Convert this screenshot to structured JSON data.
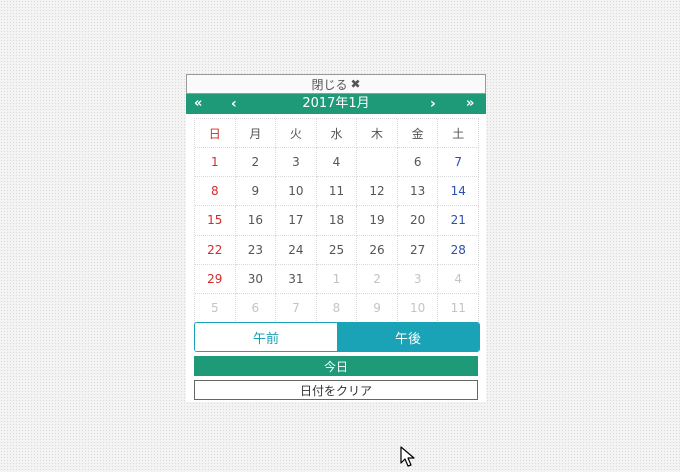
{
  "picker": {
    "close_label": "閉じる",
    "close_glyph": "✖",
    "nav": {
      "prev_year": "«",
      "prev_month": "‹",
      "title": "2017年1月",
      "next_month": "›",
      "next_year": "»"
    },
    "weekdays": [
      "日",
      "月",
      "火",
      "水",
      "木",
      "金",
      "土"
    ],
    "weeks": [
      [
        "1",
        "2",
        "3",
        "4",
        "6",
        "7"
      ],
      [
        "8",
        "9",
        "10",
        "11",
        "12",
        "13",
        "14"
      ],
      [
        "15",
        "16",
        "17",
        "18",
        "19",
        "20",
        "21"
      ],
      [
        "22",
        "23",
        "24",
        "25",
        "26",
        "27",
        "28"
      ],
      [
        "29",
        "30",
        "31",
        "1",
        "2",
        "3",
        "4"
      ],
      [
        "5",
        "6",
        "7",
        "8",
        "9",
        "10",
        "11"
      ]
    ],
    "ampm": {
      "am": "午前",
      "pm": "午後",
      "selected": "pm"
    },
    "today_label": "今日",
    "clear_label": "日付をクリア"
  },
  "colors": {
    "header_green": "#1f9a78",
    "ampm_teal": "#1aa3b7",
    "sunday_red": "#d12b2b",
    "saturday_blue": "#2d4fb0",
    "other_month_gray": "#c4c4c4"
  }
}
